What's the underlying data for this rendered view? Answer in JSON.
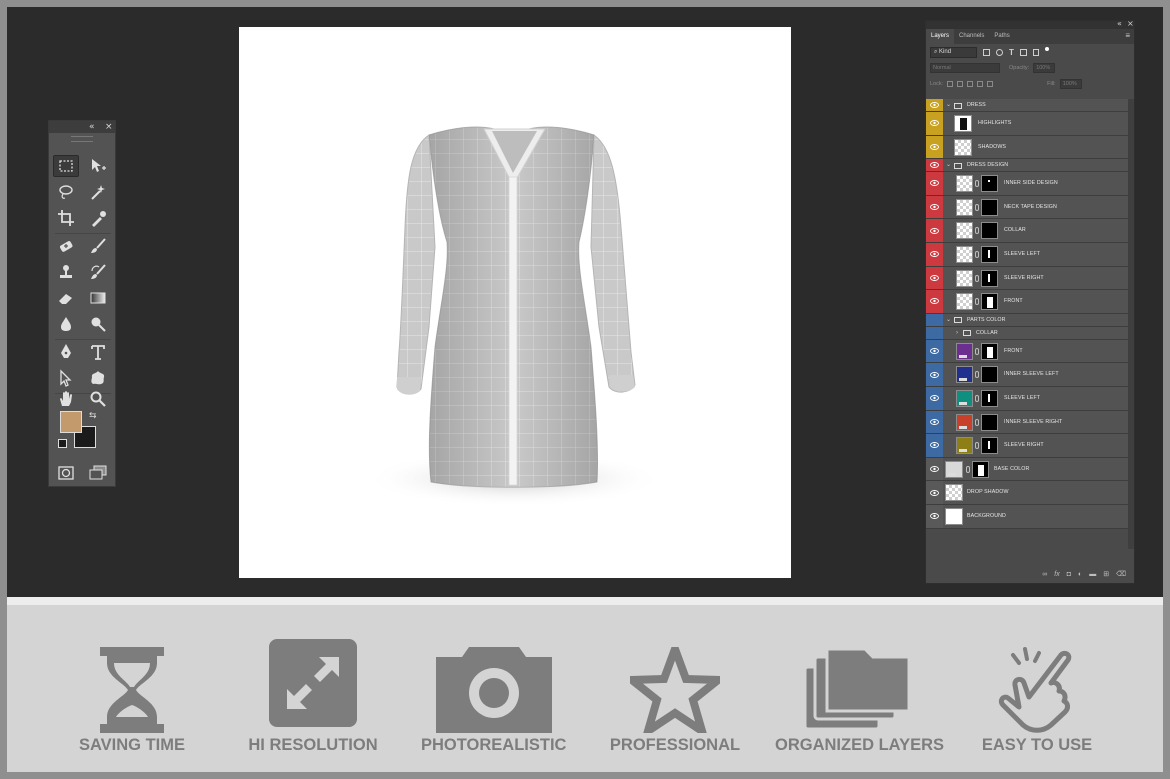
{
  "tool_panel": {
    "collapse_icon": "double-chevron-left-icon",
    "close_icon": "close-icon",
    "tools": [
      "rectangular-marquee",
      "move",
      "lasso",
      "magic-wand",
      "crop",
      "eyedropper",
      "healing-brush",
      "brush",
      "clone-stamp",
      "history-brush",
      "eraser",
      "gradient",
      "blur",
      "dodge",
      "pen",
      "type",
      "path-selection",
      "custom-shape",
      "hand",
      "zoom"
    ],
    "foreground_color": "#c29a6b",
    "background_color": "#1b1b1b"
  },
  "layers_panel": {
    "tabs": [
      "Layers",
      "Channels",
      "Paths"
    ],
    "active_tab": "Layers",
    "filter_kind": "Kind",
    "blend_mode": "Normal",
    "opacity_label": "Opacity:",
    "opacity_value": "100%",
    "lock_label": "Lock:",
    "fill_label": "Fill:",
    "fill_value": "100%",
    "groups": {
      "dress": "DRESS",
      "dress_design": "DRESS DESIGN",
      "parts_color": "PARTS COLOR",
      "collar_group": "COLLAR"
    },
    "layers": {
      "highlights": "HIGHLIGHTS",
      "shadows": "SHADOWS",
      "inner_side_design": "INNER SIDE DESIGN",
      "neck_tape_design": "NECK TAPE DESIGN",
      "collar": "COLLAR",
      "sleeve_left": "SLEEVE LEFT",
      "sleeve_right": "SLEEVE RIGHT",
      "front": "FRONT",
      "pc_front": "FRONT",
      "pc_inner_sleeve_left": "INNER SLEEVE LEFT",
      "pc_sleeve_left": "SLEEVE LEFT",
      "pc_inner_sleeve_right": "INNER SLEEVE RIGHT",
      "pc_sleeve_right": "SLEEVE RIGHT",
      "base_color": "BASE COLOR",
      "drop_shadow": "DROP SHADOW",
      "background": "BACKGROUND"
    },
    "label_colors": {
      "dress": "#c7a11f",
      "dress_design": "#cc3a3f",
      "parts_color": "#3d6aa3",
      "none": "#595959"
    },
    "swatches": {
      "front": "#6b2f8f",
      "inner_sleeve_left": "#21308f",
      "sleeve_left": "#0f8f80",
      "inner_sleeve_right": "#c83f2a",
      "sleeve_right": "#8d7e16",
      "base_color": "#d9d9d9",
      "background": "#ffffff"
    }
  },
  "features": [
    {
      "label": "SAVING TIME",
      "icon": "hourglass-icon"
    },
    {
      "label": "HI RESOLUTION",
      "icon": "expand-icon"
    },
    {
      "label": "PHOTOREALISTIC",
      "icon": "camera-icon"
    },
    {
      "label": "PROFESSIONAL",
      "icon": "star-icon"
    },
    {
      "label": "ORGANIZED LAYERS",
      "icon": "layers-folder-icon"
    },
    {
      "label": "EASY TO USE",
      "icon": "tap-hand-icon"
    }
  ],
  "colors": {
    "workspace": "#2b2b2b",
    "feature_bar": "#d4d4d4",
    "feature_icon": "#7d7d7d"
  }
}
